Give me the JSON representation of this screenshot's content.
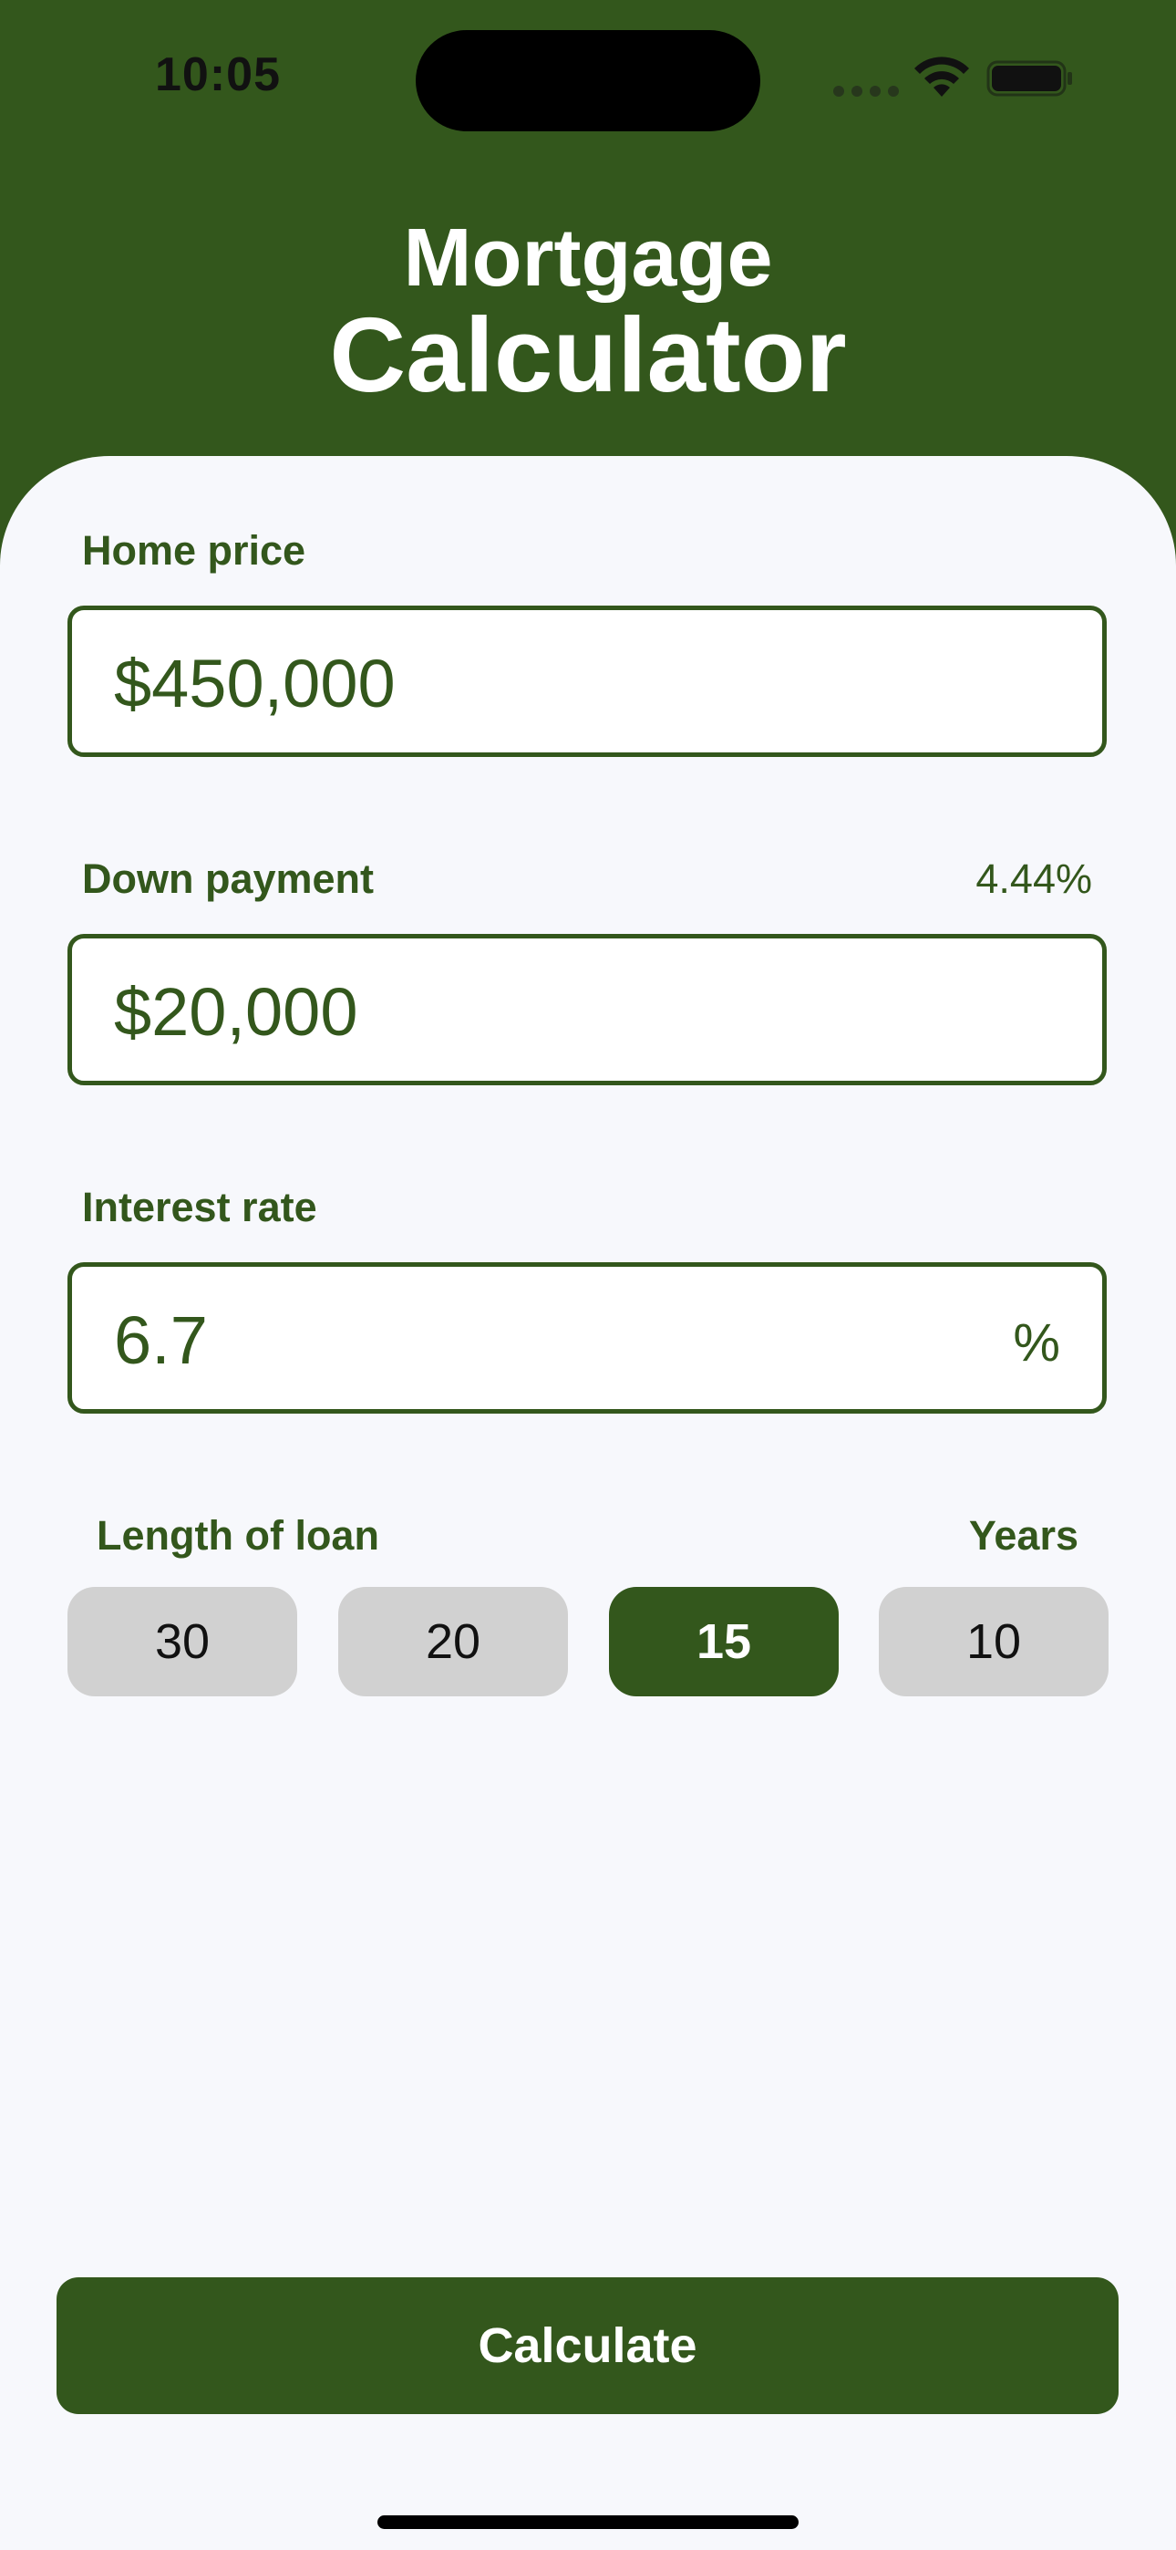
{
  "status_bar": {
    "time": "10:05"
  },
  "header": {
    "title_line1": "Mortgage",
    "title_line2": "Calculator"
  },
  "form": {
    "home_price": {
      "label": "Home price",
      "value": "$450,000"
    },
    "down_payment": {
      "label": "Down payment",
      "percent": "4.44%",
      "value": "$20,000"
    },
    "interest_rate": {
      "label": "Interest rate",
      "value": "6.7",
      "suffix": "%"
    },
    "loan_length": {
      "label": "Length of loan",
      "unit_label": "Years",
      "options": [
        "30",
        "20",
        "15",
        "10"
      ],
      "selected": "15"
    }
  },
  "calculate_button": {
    "label": "Calculate"
  },
  "colors": {
    "brand_green": "#33571c",
    "background": "#f7f8fc",
    "option_gray": "#d1d1d1"
  },
  "icons": {
    "wifi": "wifi-icon",
    "battery": "battery-icon",
    "signal": "cellular-signal-icon"
  }
}
